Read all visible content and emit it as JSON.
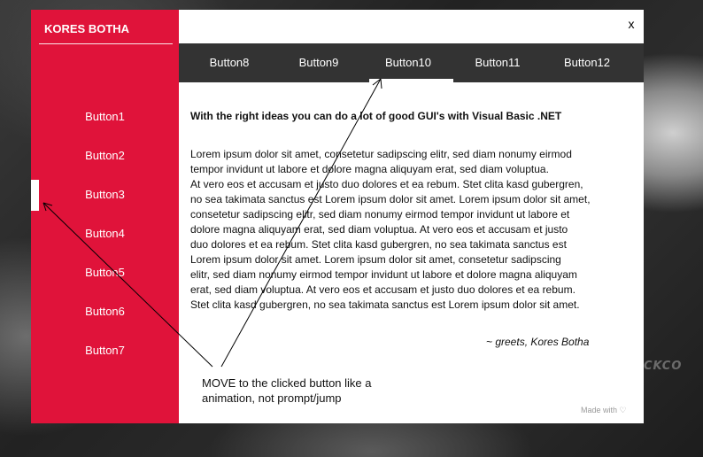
{
  "app": {
    "brand": "KORES BOTHA",
    "close_label": "x",
    "sidebar_buttons": [
      "Button1",
      "Button2",
      "Button3",
      "Button4",
      "Button5",
      "Button6",
      "Button7"
    ],
    "active_sidebar_button": "Button3",
    "top_buttons": [
      "Button8",
      "Button9",
      "Button10",
      "Button11",
      "Button12"
    ],
    "active_top_button": "Button10",
    "heading": "With the right ideas you can do a lot of good GUI's with Visual Basic .NET",
    "body_lines": [
      "Lorem ipsum dolor sit amet, consetetur sadipscing elitr, sed diam nonumy eirmod",
      "tempor invidunt ut labore et dolore magna aliquyam erat, sed diam voluptua.",
      "At vero eos et accusam et justo duo dolores et ea rebum. Stet clita kasd gubergren,",
      "no sea takimata sanctus est Lorem ipsum dolor sit amet. Lorem ipsum dolor sit amet,",
      "consetetur sadipscing elitr, sed diam nonumy eirmod tempor invidunt ut labore et",
      "dolore magna aliquyam erat, sed diam voluptua. At vero eos et accusam et justo",
      "duo dolores et ea rebum. Stet clita kasd gubergren, no sea takimata sanctus est",
      "Lorem ipsum dolor sit amet. Lorem ipsum dolor sit amet, consetetur sadipscing",
      "elitr, sed diam nonumy eirmod tempor invidunt ut labore et dolore magna aliquyam",
      "erat, sed diam voluptua. At vero eos et accusam et justo duo dolores et ea rebum.",
      "Stet clita kasd gubergren, no sea takimata sanctus est Lorem ipsum dolor sit amet."
    ],
    "signature": "~ greets, Kores Botha",
    "footer": "Made with ♡",
    "annotation_lines": [
      "MOVE to the clicked button like a",
      "animation, not prompt/jump"
    ]
  },
  "background": {
    "logo_text": "CKCO"
  },
  "colors": {
    "sidebar": "#e0133a",
    "topnav": "#333333",
    "text": "#111111"
  }
}
